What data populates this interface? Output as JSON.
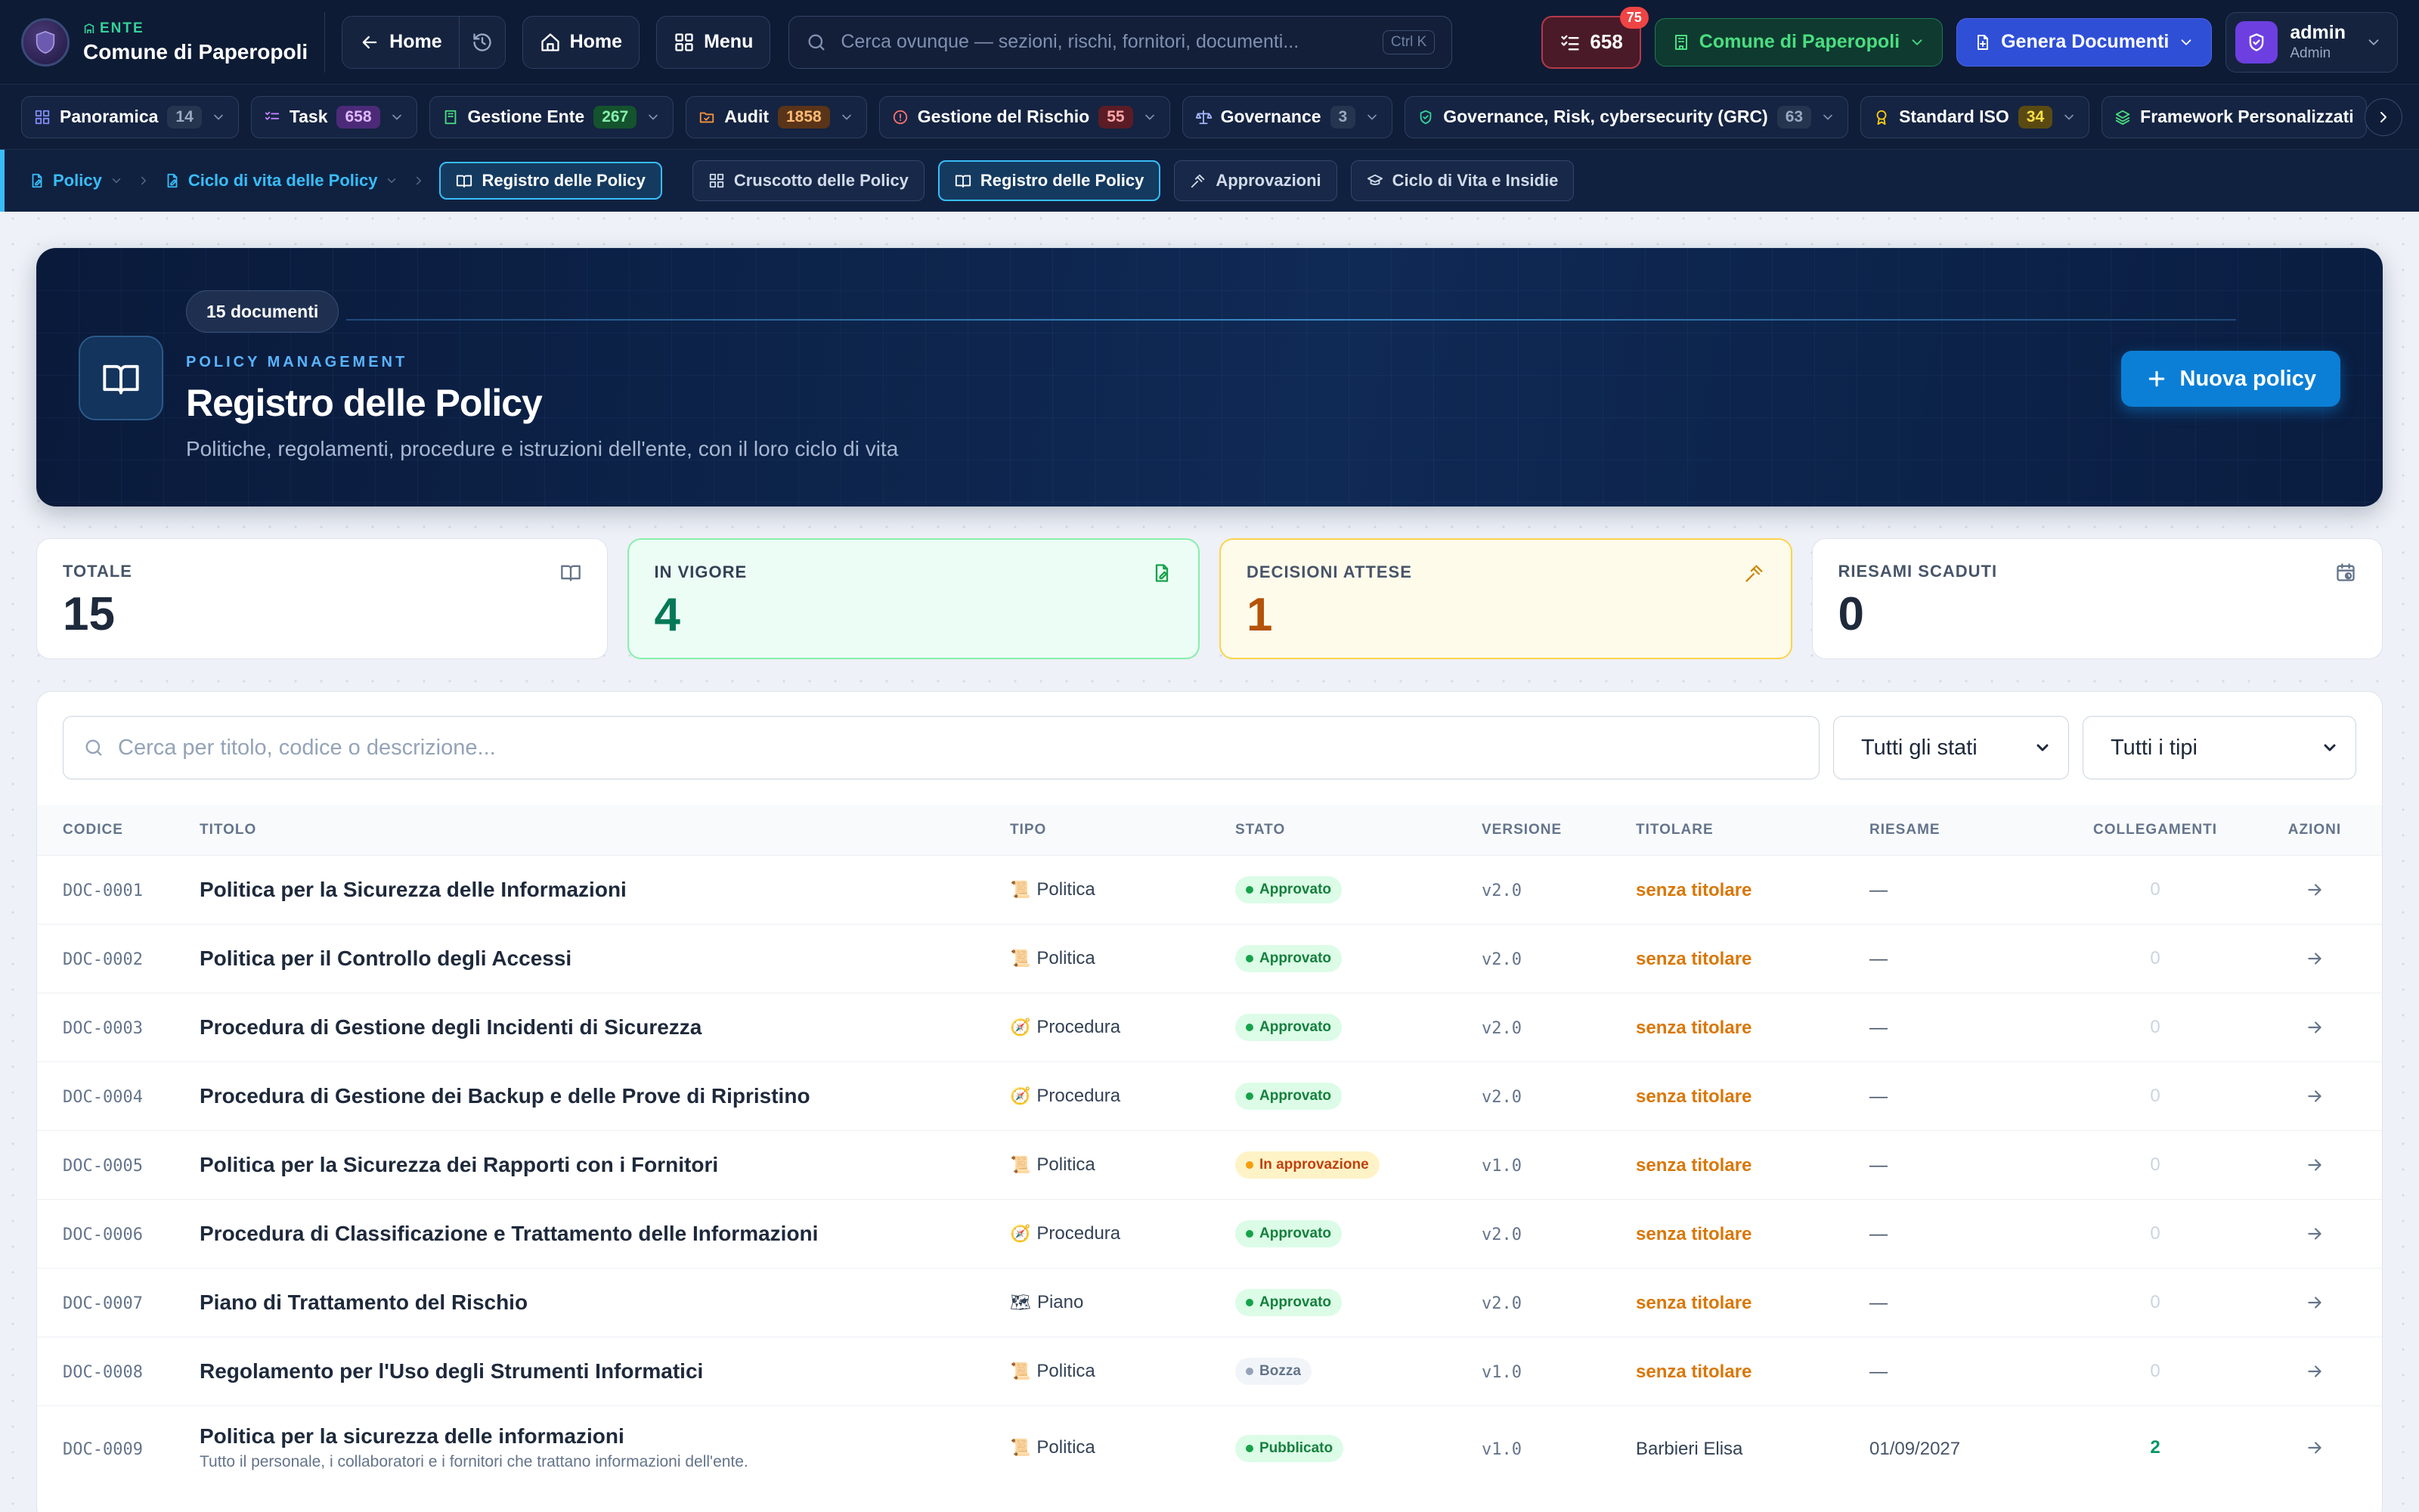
{
  "brand": {
    "eyebrow": "ENTE",
    "name": "Comune di Paperopoli"
  },
  "topbar": {
    "back_label": "Home",
    "home_label": "Home",
    "menu_label": "Menu",
    "search_placeholder": "Cerca ovunque — sezioni, rischi, fornitori, documenti...",
    "search_kbd": "Ctrl K",
    "tasks_count": "658",
    "tasks_badge": "75",
    "ente_label": "Comune di Paperopoli",
    "generate_label": "Genera Documenti",
    "user_name": "admin",
    "user_role": "Admin"
  },
  "modules": [
    {
      "label": "Panoramica",
      "count": "14",
      "icon": "grid-icon"
    },
    {
      "label": "Task",
      "count": "658",
      "icon": "checklist-icon"
    },
    {
      "label": "Gestione Ente",
      "count": "267",
      "icon": "building-icon"
    },
    {
      "label": "Audit",
      "count": "1858",
      "icon": "folder-check-icon"
    },
    {
      "label": "Gestione del Rischio",
      "count": "55",
      "icon": "alert-circle-icon"
    },
    {
      "label": "Governance",
      "count": "3",
      "icon": "scale-icon"
    },
    {
      "label": "Governance, Risk, cybersecurity (GRC)",
      "count": "63",
      "icon": "shield-check-icon"
    },
    {
      "label": "Standard ISO",
      "count": "34",
      "icon": "award-icon"
    },
    {
      "label": "Framework Personalizzati",
      "count": "",
      "icon": "layers-icon"
    }
  ],
  "subnav": {
    "crumb1": "Policy",
    "crumb2": "Ciclo di vita delle Policy",
    "current": "Registro delle Policy",
    "tabs": [
      "Cruscotto delle Policy",
      "Registro delle Policy",
      "Approvazioni",
      "Ciclo di Vita e Insidie"
    ]
  },
  "hero": {
    "doc_count": "15 documenti",
    "eyebrow": "POLICY MANAGEMENT",
    "title": "Registro delle Policy",
    "subtitle": "Politiche, regolamenti, procedure e istruzioni dell'ente, con il loro ciclo di vita",
    "new_button": "Nuova policy"
  },
  "stats": [
    {
      "label": "TOTALE",
      "value": "15"
    },
    {
      "label": "IN VIGORE",
      "value": "4"
    },
    {
      "label": "DECISIONI ATTESE",
      "value": "1"
    },
    {
      "label": "RIESAMI SCADUTI",
      "value": "0"
    }
  ],
  "filters": {
    "search_placeholder": "Cerca per titolo, codice o descrizione...",
    "state_select": "Tutti gli stati",
    "type_select": "Tutti i tipi"
  },
  "table": {
    "headers": [
      "CODICE",
      "TITOLO",
      "TIPO",
      "STATO",
      "VERSIONE",
      "TITOLARE",
      "RIESAME",
      "COLLEGAMENTI",
      "AZIONI"
    ],
    "rows": [
      {
        "code": "DOC-0001",
        "title": "Politica per la Sicurezza delle Informazioni",
        "desc": "",
        "type": "Politica",
        "type_emoji": "📜",
        "state": "Approvato",
        "state_kind": "ok",
        "version": "v2.0",
        "owner": "senza titolare",
        "review": "—",
        "links": "0"
      },
      {
        "code": "DOC-0002",
        "title": "Politica per il Controllo degli Accessi",
        "desc": "",
        "type": "Politica",
        "type_emoji": "📜",
        "state": "Approvato",
        "state_kind": "ok",
        "version": "v2.0",
        "owner": "senza titolare",
        "review": "—",
        "links": "0"
      },
      {
        "code": "DOC-0003",
        "title": "Procedura di Gestione degli Incidenti di Sicurezza",
        "desc": "",
        "type": "Procedura",
        "type_emoji": "🧭",
        "state": "Approvato",
        "state_kind": "ok",
        "version": "v2.0",
        "owner": "senza titolare",
        "review": "—",
        "links": "0"
      },
      {
        "code": "DOC-0004",
        "title": "Procedura di Gestione dei Backup e delle Prove di Ripristino",
        "desc": "",
        "type": "Procedura",
        "type_emoji": "🧭",
        "state": "Approvato",
        "state_kind": "ok",
        "version": "v2.0",
        "owner": "senza titolare",
        "review": "—",
        "links": "0"
      },
      {
        "code": "DOC-0005",
        "title": "Politica per la Sicurezza dei Rapporti con i Fornitori",
        "desc": "",
        "type": "Politica",
        "type_emoji": "📜",
        "state": "In approvazione",
        "state_kind": "wait",
        "version": "v1.0",
        "owner": "senza titolare",
        "review": "—",
        "links": "0"
      },
      {
        "code": "DOC-0006",
        "title": "Procedura di Classificazione e Trattamento delle Informazioni",
        "desc": "",
        "type": "Procedura",
        "type_emoji": "🧭",
        "state": "Approvato",
        "state_kind": "ok",
        "version": "v2.0",
        "owner": "senza titolare",
        "review": "—",
        "links": "0"
      },
      {
        "code": "DOC-0007",
        "title": "Piano di Trattamento del Rischio",
        "desc": "",
        "type": "Piano",
        "type_emoji": "🗺",
        "state": "Approvato",
        "state_kind": "ok",
        "version": "v2.0",
        "owner": "senza titolare",
        "review": "—",
        "links": "0"
      },
      {
        "code": "DOC-0008",
        "title": "Regolamento per l'Uso degli Strumenti Informatici",
        "desc": "",
        "type": "Politica",
        "type_emoji": "📜",
        "state": "Bozza",
        "state_kind": "draft",
        "version": "v1.0",
        "owner": "senza titolare",
        "review": "—",
        "links": "0"
      },
      {
        "code": "DOC-0009",
        "title": "Politica per la sicurezza delle informazioni",
        "desc": "Tutto il personale, i collaboratori e i fornitori che trattano informazioni dell'ente.",
        "type": "Politica",
        "type_emoji": "📜",
        "state": "Pubblicato",
        "state_kind": "pub",
        "version": "v1.0",
        "owner": "Barbieri Elisa",
        "review": "01/09/2027",
        "links": "2"
      }
    ]
  },
  "colors": {
    "accent": "#38bdf8",
    "primary_button": "#0b7fd6",
    "topbar": "#0e1b35",
    "approved": "#16a34a",
    "pending": "#f59e0b",
    "owner_missing": "#d97706"
  }
}
